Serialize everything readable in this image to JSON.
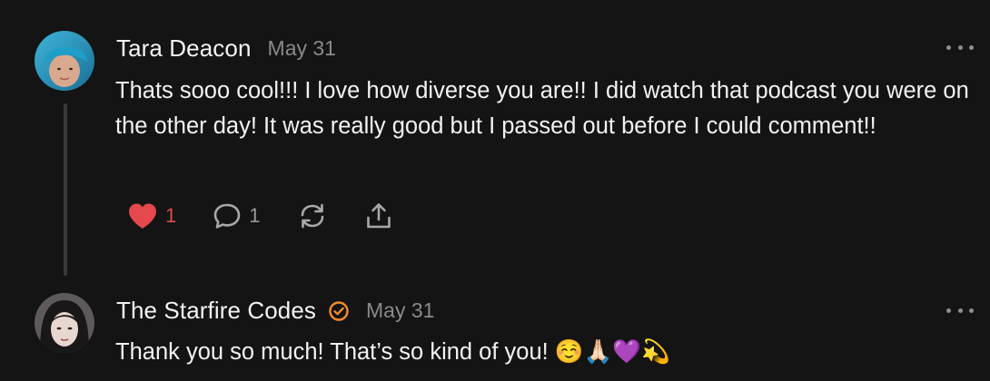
{
  "comments": [
    {
      "author": "Tara Deacon",
      "date": "May 31",
      "text": "Thats sooo cool!!! I love how diverse you are!! I did watch that podcast you were on the other day! It was really good but I passed out before I could comment!!",
      "liked": true,
      "like_count": "1",
      "reply_count": "1",
      "icons": [
        "heart-icon",
        "comment-icon",
        "restack-icon",
        "share-icon",
        "more-icon"
      ],
      "colors": {
        "like": "#e5484d",
        "muted": "#8a8a8a"
      }
    },
    {
      "author": "The Starfire Codes",
      "verified": true,
      "date": "May 31",
      "text": "Thank you so much! That’s so kind of you! ☺️🙏🏻💜💫",
      "icons": [
        "verified-icon",
        "more-icon"
      ],
      "colors": {
        "verified": "#f28b2e"
      }
    }
  ]
}
